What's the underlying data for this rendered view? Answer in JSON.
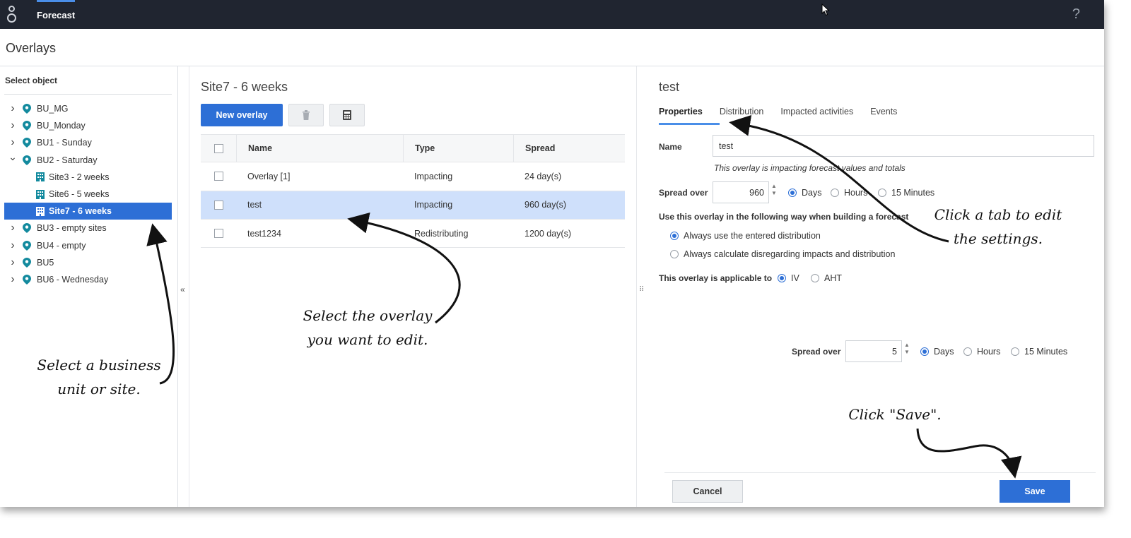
{
  "topbar": {
    "module": "Forecast",
    "help": "?"
  },
  "page": {
    "title": "Overlays"
  },
  "left": {
    "title": "Select object",
    "tree": [
      {
        "label": "BU_MG",
        "level": 0,
        "expanded": false
      },
      {
        "label": "BU_Monday",
        "level": 0,
        "expanded": false
      },
      {
        "label": "BU1 - Sunday",
        "level": 0,
        "expanded": false
      },
      {
        "label": "BU2 - Saturday",
        "level": 0,
        "expanded": true
      },
      {
        "label": "Site3 - 2 weeks",
        "level": 1
      },
      {
        "label": "Site6 - 5 weeks",
        "level": 1
      },
      {
        "label": "Site7 - 6 weeks",
        "level": 1,
        "selected": true
      },
      {
        "label": "BU3 - empty sites",
        "level": 0,
        "expanded": false
      },
      {
        "label": "BU4 - empty",
        "level": 0,
        "expanded": false
      },
      {
        "label": "BU5",
        "level": 0,
        "expanded": false
      },
      {
        "label": "BU6 - Wednesday",
        "level": 0,
        "expanded": false
      }
    ]
  },
  "middle": {
    "title": "Site7 - 6 weeks",
    "new_overlay_label": "New overlay",
    "columns": {
      "name": "Name",
      "type": "Type",
      "spread": "Spread"
    },
    "rows": [
      {
        "name": "Overlay [1]",
        "type": "Impacting",
        "spread": "24 day(s)"
      },
      {
        "name": "test",
        "type": "Impacting",
        "spread": "960 day(s)"
      },
      {
        "name": "test1234",
        "type": "Redistributing",
        "spread": "1200 day(s)"
      }
    ]
  },
  "right": {
    "title": "test",
    "tabs": [
      "Properties",
      "Distribution",
      "Impacted activities",
      "Events"
    ],
    "name_label": "Name",
    "name_value": "test",
    "hint": "This overlay is impacting forecast values and totals",
    "spread_label": "Spread over",
    "spread_value": "960",
    "units": [
      "Days",
      "Hours",
      "15 Minutes"
    ],
    "usage_label": "Use this overlay in the following way when building a forecast",
    "usage_options": [
      "Always use the entered distribution",
      "Always calculate disregarding impacts and distribution"
    ],
    "applicable_label": "This overlay is applicable to",
    "applicable_options": [
      "IV",
      "AHT"
    ],
    "spread2_label": "Spread over",
    "spread2_value": "5",
    "cancel_label": "Cancel",
    "save_label": "Save"
  },
  "annotations": {
    "select_business_unit": [
      "Select a business",
      "unit or site."
    ],
    "select_overlay": [
      "Select the overlay",
      "you want to edit."
    ],
    "click_tab": [
      "Click a tab to edit",
      "the settings."
    ],
    "click_save": "Click \"Save\"."
  },
  "colors": {
    "topbar": "#202530",
    "accent": "#2d6fd6",
    "selected_row": "#cfe0fb",
    "pin": "#138a9e"
  }
}
